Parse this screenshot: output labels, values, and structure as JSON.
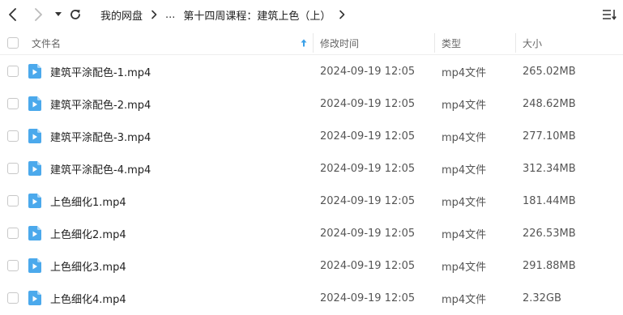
{
  "toolbar": {
    "back_icon": "chevron-left-icon",
    "forward_icon": "chevron-right-icon",
    "history_icon": "caret-down-icon",
    "refresh_icon": "refresh-icon",
    "sort_icon": "sort-menu-icon"
  },
  "breadcrumb": {
    "root": "我的网盘",
    "ellipsis": "...",
    "parent": "第十四周课程：建筑上色（上）"
  },
  "columns": {
    "name": "文件名",
    "modified": "修改时间",
    "type": "类型",
    "size": "大小"
  },
  "colors": {
    "accent": "#3aa0e8",
    "file_icon": "#4ba9ec"
  },
  "files": [
    {
      "name": "建筑平涂配色-1.mp4",
      "modified": "2024-09-19 12:05",
      "type": "mp4文件",
      "size": "265.02MB"
    },
    {
      "name": "建筑平涂配色-2.mp4",
      "modified": "2024-09-19 12:05",
      "type": "mp4文件",
      "size": "248.62MB"
    },
    {
      "name": "建筑平涂配色-3.mp4",
      "modified": "2024-09-19 12:05",
      "type": "mp4文件",
      "size": "277.10MB"
    },
    {
      "name": "建筑平涂配色-4.mp4",
      "modified": "2024-09-19 12:05",
      "type": "mp4文件",
      "size": "312.34MB"
    },
    {
      "name": "上色细化1.mp4",
      "modified": "2024-09-19 12:05",
      "type": "mp4文件",
      "size": "181.44MB"
    },
    {
      "name": "上色细化2.mp4",
      "modified": "2024-09-19 12:05",
      "type": "mp4文件",
      "size": "226.53MB"
    },
    {
      "name": "上色细化3.mp4",
      "modified": "2024-09-19 12:05",
      "type": "mp4文件",
      "size": "291.88MB"
    },
    {
      "name": "上色细化4.mp4",
      "modified": "2024-09-19 12:05",
      "type": "mp4文件",
      "size": "2.32GB"
    }
  ]
}
